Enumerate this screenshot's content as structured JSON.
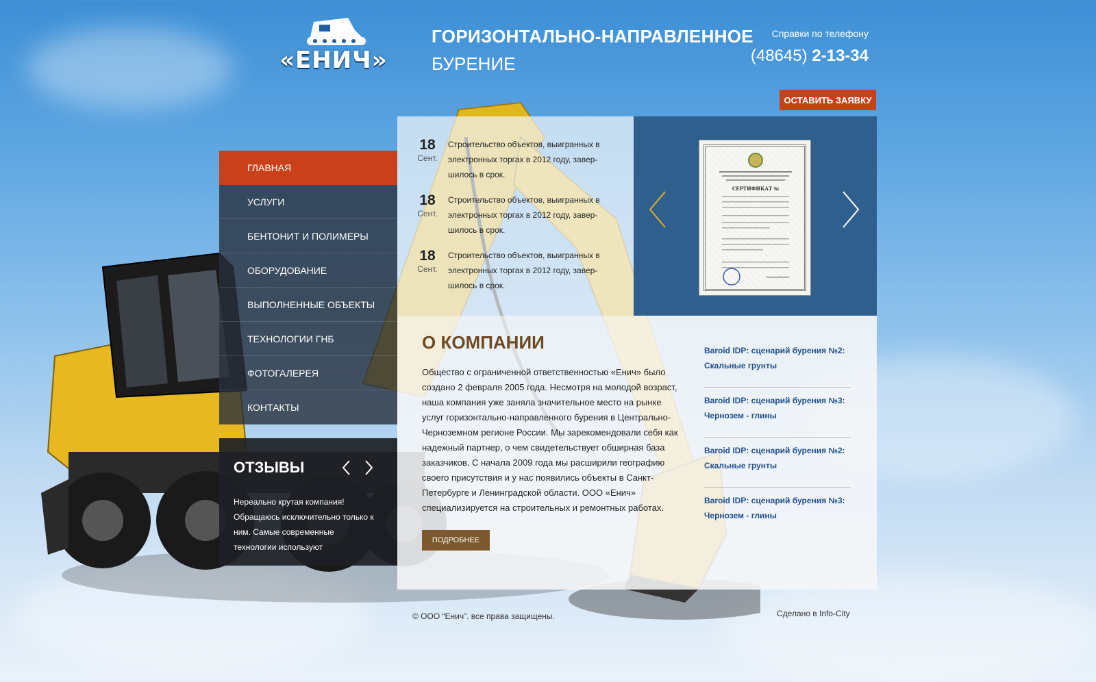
{
  "header": {
    "logo_text": "«ЕНИЧ»",
    "title_line1": "ГОРИЗОНТАЛЬНО-НАПРАВЛЕННОЕ",
    "title_line2": "БУРЕНИЕ",
    "phone_label": "Справки по телефону",
    "phone_code": "(48645)",
    "phone_number": "2-13-34",
    "cta_label": "ОСТАВИТЬ ЗАЯВКУ"
  },
  "menu": {
    "items": [
      {
        "label": "ГЛАВНАЯ",
        "active": true
      },
      {
        "label": "УСЛУГИ",
        "active": false
      },
      {
        "label": "БЕНТОНИТ И ПОЛИМЕРЫ",
        "active": false
      },
      {
        "label": "ОБОРУДОВАНИЕ",
        "active": false
      },
      {
        "label": "ВЫПОЛНЕННЫЕ ОБЪЕКТЫ",
        "active": false
      },
      {
        "label": "ТЕХНОЛОГИИ ГНБ",
        "active": false
      },
      {
        "label": "ФОТОГАЛЕРЕЯ",
        "active": false
      },
      {
        "label": "КОНТАКТЫ",
        "active": false
      }
    ]
  },
  "reviews": {
    "title": "ОТЗЫВЫ",
    "text": "Нереально крутая компания! Обращаюсь исключительно только к ним. Самые современные технологии используют"
  },
  "news": [
    {
      "day": "18",
      "month": "Сент.",
      "text": "Строительство объектов, выигранных в электронных торгах в 2012 году, завер-шилось в срок."
    },
    {
      "day": "18",
      "month": "Сент.",
      "text": "Строительство объектов, выигранных в электронных торгах в 2012 году, завер-шилось в срок."
    },
    {
      "day": "18",
      "month": "Сент.",
      "text": "Строительство объектов, выигранных в электронных торгах в 2012 году, завер-шилось в срок."
    }
  ],
  "certificate": {
    "heading": "СЕРТИФИКАТ №"
  },
  "about": {
    "title": "О КОМПАНИИ",
    "text": "Общество с ограниченной ответственностью «Енич» было создано 2 февраля 2005 года. Несмотря на молодой возраст, наша компания уже заняла значительное место на рынке услуг горизонтально-направленного бурения в Центрально-Черноземном регионе России. Мы зарекомендовали себя как надежный партнер, о чем свидетельствует обширная база заказчиков. С начала 2009 года мы расширили географию своего присутствия и у нас появились объекты в Санкт-Петербурге и Ленинградской области. ООО «Енич» специализируется на строительных и ремонтных работах.",
    "more_label": "ПОДРОБНЕЕ"
  },
  "links": [
    "Baroid IDP: сценарий бурения №2: Скальные грунты",
    "Baroid IDP: сценарий бурения №3: Чернозем - глины",
    "Baroid IDP: сценарий бурения №2: Скальные грунты",
    "Baroid IDP: сценарий бурения №3: Чернозем - глины"
  ],
  "footer": {
    "copyright": "© ООО “Енич”. все права защищены.",
    "made_by": "Сделано в Info-City"
  },
  "colors": {
    "accent": "#c8411a",
    "brown": "#7d5a2d",
    "blue_panel": "#2f5f8c",
    "link": "#1f4f8c"
  }
}
